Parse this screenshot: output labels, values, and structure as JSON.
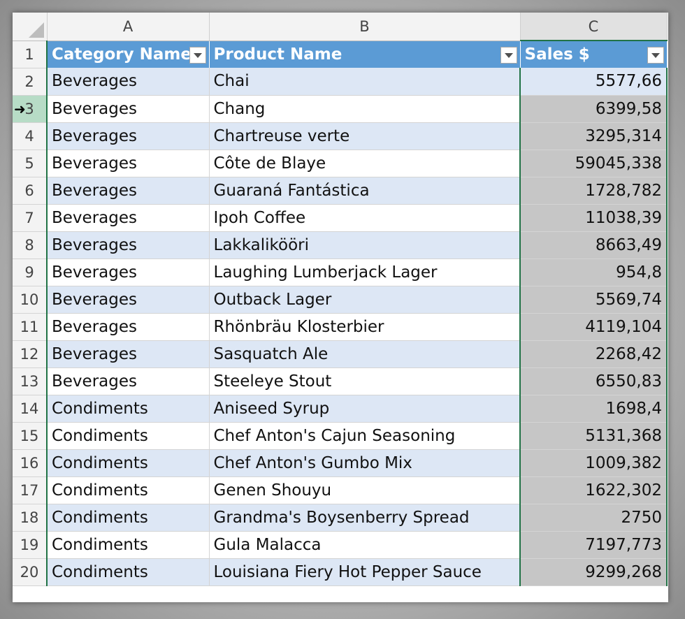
{
  "sheet": {
    "column_headers": [
      "A",
      "B",
      "C"
    ],
    "table_headers": {
      "a": "Category Name",
      "b": "Product Name",
      "c": "Sales $"
    },
    "rows": [
      {
        "n": "2",
        "cat": "Beverages",
        "prod": "Chai",
        "sales": "5577,66"
      },
      {
        "n": "3",
        "cat": "Beverages",
        "prod": "Chang",
        "sales": "6399,58"
      },
      {
        "n": "4",
        "cat": "Beverages",
        "prod": "Chartreuse verte",
        "sales": "3295,314"
      },
      {
        "n": "5",
        "cat": "Beverages",
        "prod": "Côte de Blaye",
        "sales": "59045,338"
      },
      {
        "n": "6",
        "cat": "Beverages",
        "prod": "Guaraná Fantástica",
        "sales": "1728,782"
      },
      {
        "n": "7",
        "cat": "Beverages",
        "prod": "Ipoh Coffee",
        "sales": "11038,39"
      },
      {
        "n": "8",
        "cat": "Beverages",
        "prod": "Lakkalikööri",
        "sales": "8663,49"
      },
      {
        "n": "9",
        "cat": "Beverages",
        "prod": "Laughing Lumberjack Lager",
        "sales": "954,8"
      },
      {
        "n": "10",
        "cat": "Beverages",
        "prod": "Outback Lager",
        "sales": "5569,74"
      },
      {
        "n": "11",
        "cat": "Beverages",
        "prod": "Rhönbräu Klosterbier",
        "sales": "4119,104"
      },
      {
        "n": "12",
        "cat": "Beverages",
        "prod": "Sasquatch Ale",
        "sales": "2268,42"
      },
      {
        "n": "13",
        "cat": "Beverages",
        "prod": "Steeleye Stout",
        "sales": "6550,83"
      },
      {
        "n": "14",
        "cat": "Condiments",
        "prod": "Aniseed Syrup",
        "sales": "1698,4"
      },
      {
        "n": "15",
        "cat": "Condiments",
        "prod": "Chef Anton's Cajun Seasoning",
        "sales": "5131,368"
      },
      {
        "n": "16",
        "cat": "Condiments",
        "prod": "Chef Anton's Gumbo Mix",
        "sales": "1009,382"
      },
      {
        "n": "17",
        "cat": "Condiments",
        "prod": "Genen Shouyu",
        "sales": "1622,302"
      },
      {
        "n": "18",
        "cat": "Condiments",
        "prod": "Grandma's Boysenberry Spread",
        "sales": "2750"
      },
      {
        "n": "19",
        "cat": "Condiments",
        "prod": "Gula Malacca",
        "sales": "7197,773"
      },
      {
        "n": "20",
        "cat": "Condiments",
        "prod": "Louisiana Fiery Hot Pepper Sauce",
        "sales": "9299,268"
      }
    ],
    "header_row_number": "1",
    "colors": {
      "table_header": "#5b9bd5",
      "band": "#dde7f5",
      "selection": "#c6c6c6",
      "selection_border": "#217346"
    },
    "selected_column": "C",
    "cursor_icon": "move-arrow-icon"
  }
}
